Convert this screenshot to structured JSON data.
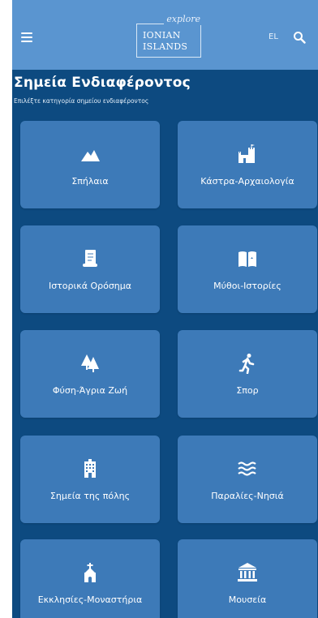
{
  "header": {
    "logo_tag": "explore",
    "logo_line1": "IONIAN",
    "logo_line2": "ISLANDS",
    "language": "EL"
  },
  "page": {
    "title": "Σημεία Ενδιαφέροντος",
    "subtitle": "Επιλέξτε κατηγορία σημείου ενδιαφέροντος"
  },
  "categories": [
    {
      "label": "Σπήλαια",
      "icon": "mountain-icon"
    },
    {
      "label": "Κάστρα-Αρχαιολογία",
      "icon": "castle-icon"
    },
    {
      "label": "Ιστορικά Ορόσημα",
      "icon": "scroll-icon"
    },
    {
      "label": "Μύθοι-Ιστορίες",
      "icon": "book-icon"
    },
    {
      "label": "Φύση-Άγρια Ζωή",
      "icon": "trees-icon"
    },
    {
      "label": "Σπορ",
      "icon": "running-icon"
    },
    {
      "label": "Σημεία της πόλης",
      "icon": "building-icon"
    },
    {
      "label": "Παραλίες-Νησιά",
      "icon": "water-icon"
    },
    {
      "label": "Εκκλησίες-Μοναστήρια",
      "icon": "church-icon"
    },
    {
      "label": "Μουσεία",
      "icon": "museum-icon"
    }
  ]
}
